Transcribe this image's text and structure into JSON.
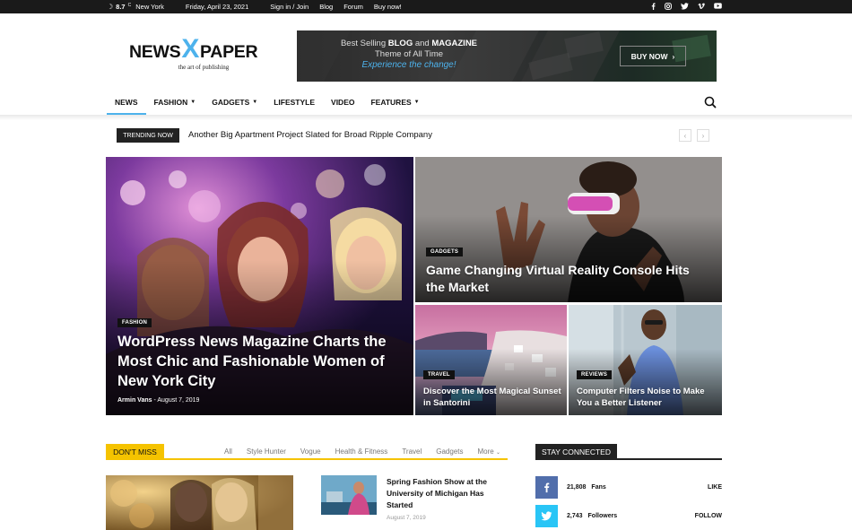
{
  "topbar": {
    "temperature": "8.7",
    "unit": "C",
    "city": "New York",
    "date": "Friday, April 23, 2021",
    "links": [
      "Sign in / Join",
      "Blog",
      "Forum",
      "Buy now!"
    ],
    "social_icons": [
      "facebook-icon",
      "instagram-icon",
      "twitter-icon",
      "vimeo-icon",
      "youtube-icon"
    ]
  },
  "logo": {
    "part1": "NEWS",
    "part2": "X",
    "part3": "PAPER",
    "tagline": "the art of publishing"
  },
  "banner": {
    "line1_a": "Best Selling ",
    "line1_b": "BLOG",
    "line1_c": " and ",
    "line1_d": "MAGAZINE",
    "line2": "Theme of All Time",
    "line3": "Experience the change!",
    "button": "BUY NOW"
  },
  "nav": {
    "items": [
      {
        "label": "NEWS"
      },
      {
        "label": "FASHION"
      },
      {
        "label": "GADGETS"
      },
      {
        "label": "LIFESTYLE"
      },
      {
        "label": "VIDEO"
      },
      {
        "label": "FEATURES"
      }
    ]
  },
  "trending": {
    "label": "TRENDING NOW",
    "headline": "Another Big Apartment Project Slated for Broad Ripple Company"
  },
  "hero": {
    "main": {
      "category": "FASHION",
      "title": "WordPress News Magazine Charts the Most Chic and Fashionable Women of New York City",
      "author": "Armin Vans",
      "date": "August 7, 2019"
    },
    "top_right": {
      "category": "GADGETS",
      "title": "Game Changing Virtual Reality Console Hits the Market"
    },
    "bottom_left": {
      "category": "TRAVEL",
      "title": "Discover the Most Magical Sunset in Santorini"
    },
    "bottom_right": {
      "category": "REVIEWS",
      "title": "Computer Filters Noise to Make You a Better Listener"
    }
  },
  "dont_miss": {
    "label": "DON'T MISS",
    "tabs": [
      "All",
      "Style Hunter",
      "Vogue",
      "Health & Fitness",
      "Travel",
      "Gadgets",
      "More"
    ],
    "side_post": {
      "title": "Spring Fashion Show at the University of Michigan Has Started",
      "date": "August 7, 2019"
    }
  },
  "stay_connected": {
    "label": "STAY CONNECTED",
    "rows": [
      {
        "count": "21,808",
        "type": "Fans",
        "action": "LIKE",
        "color": "#516eab"
      },
      {
        "count": "2,743",
        "type": "Followers",
        "action": "FOLLOW",
        "color": "#29c5f6"
      }
    ]
  },
  "colors": {
    "accent": "#4db2ec",
    "dont_miss": "#f5c300",
    "dark": "#222222"
  }
}
